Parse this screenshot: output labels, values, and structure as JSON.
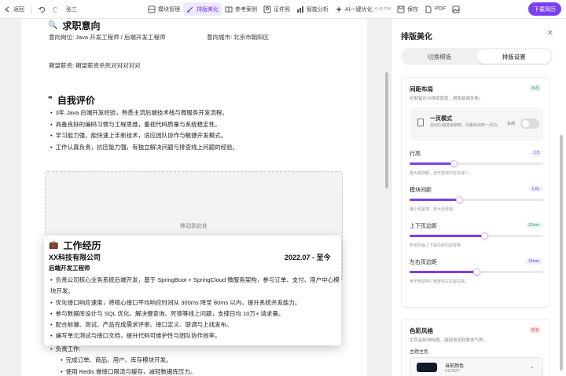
{
  "toolbar": {
    "back": "返回",
    "doc_name": "张三",
    "items": [
      "模块管理",
      "排版美化",
      "参考案例",
      "证件照",
      "智能分析",
      "AI一键优化"
    ],
    "time": "4:42 PM",
    "save": "保存",
    "pdf": "PDF",
    "download": "下载简历",
    "accent_color": "#7b3ff2"
  },
  "resume": {
    "intention_title": "求职意向",
    "intention_position": "意向岗位: Java 开发工程师 / 后端开发工程师",
    "intention_city": "意向城市: 北京市朝阳区",
    "intention_salary": "期望薪资: 期望薪资杀死对对对对对",
    "evaluation_title": "自我评价",
    "evaluation_items": [
      "3年 Java 后端开发经验，熟悉主流后端技术栈与微服务开发流程。",
      "具备良好的编码习惯与工程思维，重视代码质量与系统稳定性。",
      "学习能力强，能快速上手新技术，适应团队协作与敏捷开发模式。",
      "工作认真负责，抗压能力强，有独立解决问题与排查线上问题的经验。"
    ],
    "dropzone_text": "移动到此处",
    "work_title": "工作经历",
    "company": "XX科技有限公司",
    "period": "2022.07 - 至今",
    "role": "后端开发工程师",
    "work_items": [
      "负责公司核心业务系统后端开发，基于 SpringBoot + SpringCloud 微服务架构，参与订单、支付、用户中心模块开发。",
      "优化接口响应速度，将核心接口平均响应时间从 300ms 降至 80ms 以内，提升系统并发能力。",
      "参与数据库设计与 SQL 优化，解决慢查询、死锁等线上问题，支撑日均 10万+ 请求量。",
      "配合前端、测试、产品完成需求评审、接口定义、联调与上线发布。",
      "编写单元测试与接口文档，提升代码可维护性与团队协作效率。"
    ],
    "bg_section_label": "负责工作:",
    "bg_items": [
      "完成订单、商品、用户、库存模块开发。",
      "使用 Redis 做接口限流与缓存，减轻数据库压力。"
    ]
  },
  "panel": {
    "title": "排版美化",
    "tabs": [
      "切换模板",
      "排版设置"
    ],
    "spacing": {
      "title": "间距布局",
      "desc": "控制留白与排版密度，避免版面失衡。",
      "badge": "布局",
      "one_page_title": "一页模式",
      "one_page_desc": "自动压缩排版参数，尽量收纳到一页内。",
      "one_page_state": "关闭",
      "settings": [
        {
          "label": "行高",
          "value": "1.5",
          "hint": "越大越舒朗，但可容纳内容会减少。",
          "fraction": 0.33
        },
        {
          "label": "模块间距",
          "value": "1.0x",
          "hint": "缩小更紧凑，放大更舒展。",
          "fraction": 0.37
        },
        {
          "label": "上下页边距",
          "value": "22mm",
          "hint": "影响页面上下留白和内容容量。",
          "fraction": 0.56
        },
        {
          "label": "左右页边距",
          "value": "15mm",
          "hint": "用于微调核心宽度和左右留白感。",
          "fraction": 0.5
        }
      ]
    },
    "color": {
      "title": "色彩风格",
      "desc": "主色会影响标题、强调信息和整体气质。",
      "badge": "颜色",
      "label": "主题主色",
      "current_name": "当前颜色",
      "current_hex": "#111827",
      "swatch": "#111827"
    }
  }
}
